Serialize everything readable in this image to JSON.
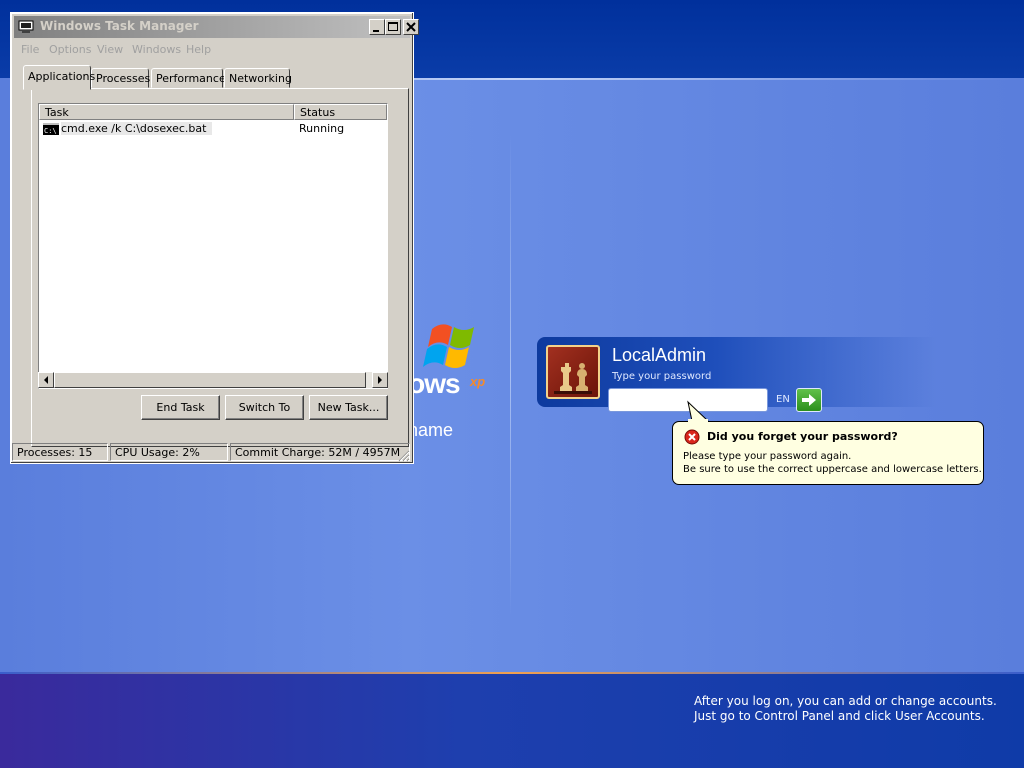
{
  "task_manager": {
    "title": "Windows Task Manager",
    "menu": [
      "File",
      "Options",
      "View",
      "Windows",
      "Help"
    ],
    "tabs": [
      "Applications",
      "Processes",
      "Performance",
      "Networking"
    ],
    "active_tab": "Applications",
    "columns": {
      "task": "Task",
      "status": "Status"
    },
    "rows": [
      {
        "task": "cmd.exe /k C:\\dosexec.bat",
        "status": "Running",
        "icon": "console-icon"
      }
    ],
    "buttons": {
      "end_task": "End Task",
      "switch_to": "Switch To",
      "new_task": "New Task..."
    },
    "statusbar": {
      "processes": "Processes: 15",
      "cpu": "CPU Usage: 2%",
      "commit": "Commit Charge: 52M / 4957M"
    }
  },
  "welcome": {
    "logo_text": "dows",
    "logo_superscript": "xp",
    "logo_subtitle": "name",
    "user": {
      "name": "LocalAdmin",
      "prompt": "Type your password",
      "password_value": "",
      "language": "EN",
      "picture": "chess-pieces-picture"
    },
    "balloon": {
      "title": "Did you forget your password?",
      "line1": "Please type your password again.",
      "line2": "Be sure to use the correct uppercase and lowercase letters."
    },
    "bottom_hint": {
      "line1": "After you log on, you can add or change accounts.",
      "line2": "Just go to Control Panel and click User Accounts."
    }
  },
  "colors": {
    "background": "#5a7edc",
    "top_band": "#00309c",
    "balloon_bg": "#ffffe1",
    "go_button": "#2c8f1c",
    "window_face": "#d4d0c8"
  }
}
